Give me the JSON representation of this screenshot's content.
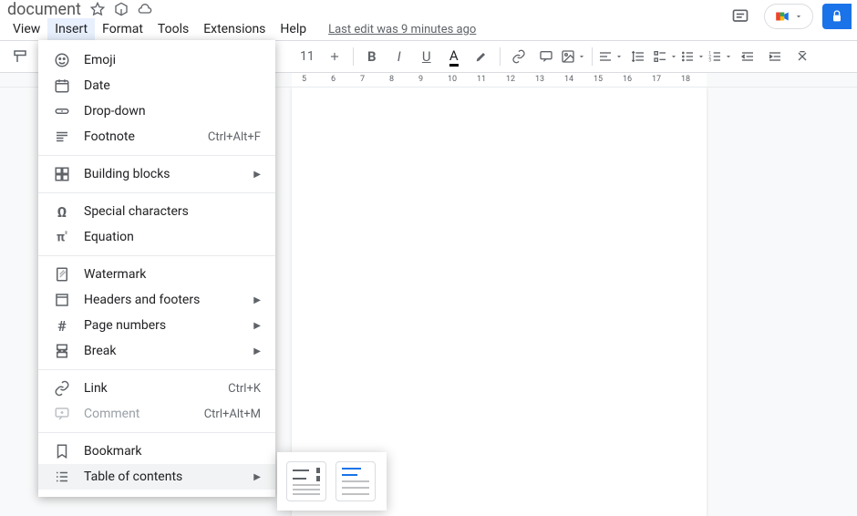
{
  "titlebar": {
    "title": "document"
  },
  "menubar": {
    "items": [
      "View",
      "Insert",
      "Format",
      "Tools",
      "Extensions",
      "Help"
    ],
    "active_index": 1,
    "last_edit": "Last edit was 9 minutes ago"
  },
  "toolbar": {
    "font_size": "11"
  },
  "ruler": {
    "ticks": [
      "5",
      "6",
      "7",
      "8",
      "9",
      "10",
      "11",
      "12",
      "13",
      "14",
      "15",
      "16",
      "17",
      "18"
    ]
  },
  "insert_menu": {
    "groups": [
      [
        {
          "icon": "emoji",
          "label": "Emoji"
        },
        {
          "icon": "date",
          "label": "Date"
        },
        {
          "icon": "dropdown",
          "label": "Drop-down"
        },
        {
          "icon": "footnote",
          "label": "Footnote",
          "shortcut": "Ctrl+Alt+F"
        }
      ],
      [
        {
          "icon": "blocks",
          "label": "Building blocks",
          "submenu": true
        }
      ],
      [
        {
          "icon": "omega",
          "label": "Special characters"
        },
        {
          "icon": "pi",
          "label": "Equation"
        }
      ],
      [
        {
          "icon": "watermark",
          "label": "Watermark"
        },
        {
          "icon": "headers",
          "label": "Headers and footers",
          "submenu": true
        },
        {
          "icon": "pagenum",
          "label": "Page numbers",
          "submenu": true
        },
        {
          "icon": "break",
          "label": "Break",
          "submenu": true
        }
      ],
      [
        {
          "icon": "link",
          "label": "Link",
          "shortcut": "Ctrl+K"
        },
        {
          "icon": "comment",
          "label": "Comment",
          "shortcut": "Ctrl+Alt+M",
          "disabled": true
        }
      ],
      [
        {
          "icon": "bookmark",
          "label": "Bookmark"
        },
        {
          "icon": "toc",
          "label": "Table of contents",
          "submenu": true,
          "highlighted": true
        }
      ]
    ]
  }
}
